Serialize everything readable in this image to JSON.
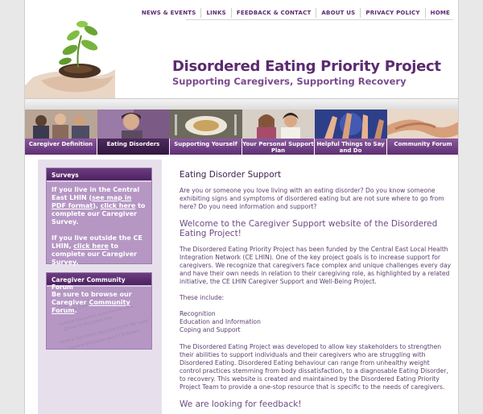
{
  "nav": [
    "NEWS & EVENTS",
    "LINKS",
    "FEEDBACK & CONTACT",
    "ABOUT US",
    "PRIVACY POLICY",
    "HOME"
  ],
  "header": {
    "title": "Disordered Eating Priority Project",
    "subtitle": "Supporting Caregivers, Supporting Recovery"
  },
  "tabs": [
    {
      "label": "Caregiver Definition",
      "icon": "group-photo",
      "active": false
    },
    {
      "label": "Eating Disorders",
      "icon": "portrait-photo",
      "active": true
    },
    {
      "label": "Supporting Yourself",
      "icon": "plate-photo",
      "active": false
    },
    {
      "label": "Your Personal Support Plan",
      "icon": "two-women-photo",
      "active": false
    },
    {
      "label": "Helpful Things to Say and Do",
      "icon": "hands-photo",
      "active": false
    },
    {
      "label": "Community Forum",
      "icon": "holding-hands-photo",
      "active": false
    }
  ],
  "sidebar": {
    "surveys": {
      "title": "Surveys",
      "p1_a": "If you live in the Central East LHIN (",
      "p1_link1": "see map in PDF format",
      "p1_b": "), ",
      "p1_link2": "click here",
      "p1_c": " to complete our Caregiver Survey.",
      "p2_a": "If you live outside the CE LHIN, ",
      "p2_link": "click here",
      "p2_b": " to complete our Caregiver Survey."
    },
    "forum": {
      "title": "Caregiver Community Forum",
      "text_a": "Be sure to browse our Caregiver ",
      "link": "Community Forum",
      "text_b": ".",
      "faint_lines": [
        "General discussion about self care",
        "Family Care",
        "General discussion about Family Care",
        "Caring for My Loved One",
        "General discussion about Caring for My Loved",
        "General discussion about CE Project"
      ]
    }
  },
  "main": {
    "heading": "Eating Disorder Support",
    "intro": "Are you or someone you love living with an eating disorder? Do you know someone exhibiting signs and symptoms of disordered eating but are not sure where to go from here? Do you need information and support?",
    "welcome": "Welcome to the Caregiver Support website of the Disordered Eating Project!",
    "p1": "The Disordered Eating Priority Project has been funded by the Central East Local Health Integration Network (CE LHIN). One of the key project goals is to increase support for caregivers. We recognize that caregivers face complex and unique challenges every day and have their own needs in relation to their caregiving role, as highlighted by a related initiative, the CE LHIN Caregiver Support and Well-Being Project.",
    "include_label": "These include:",
    "include_items": [
      "Recognition",
      "Education and Information",
      "Coping and Support"
    ],
    "p2": "The Disordered Eating Project was developed to allow key stakeholders to strengthen their abilities to support individuals and their caregivers who are struggling with Disordered Eating. Disordered Eating behaviour can range from unhealthy weight control practices stemming from body dissatisfaction, to a diagnosable Eating Disorder, to recovery. This website is created and maintained by the Disordered Eating Priority Project Team to provide a one-stop resource that is specific to the needs of caregivers.",
    "feedback_heading": "We are looking for feedback!"
  }
}
